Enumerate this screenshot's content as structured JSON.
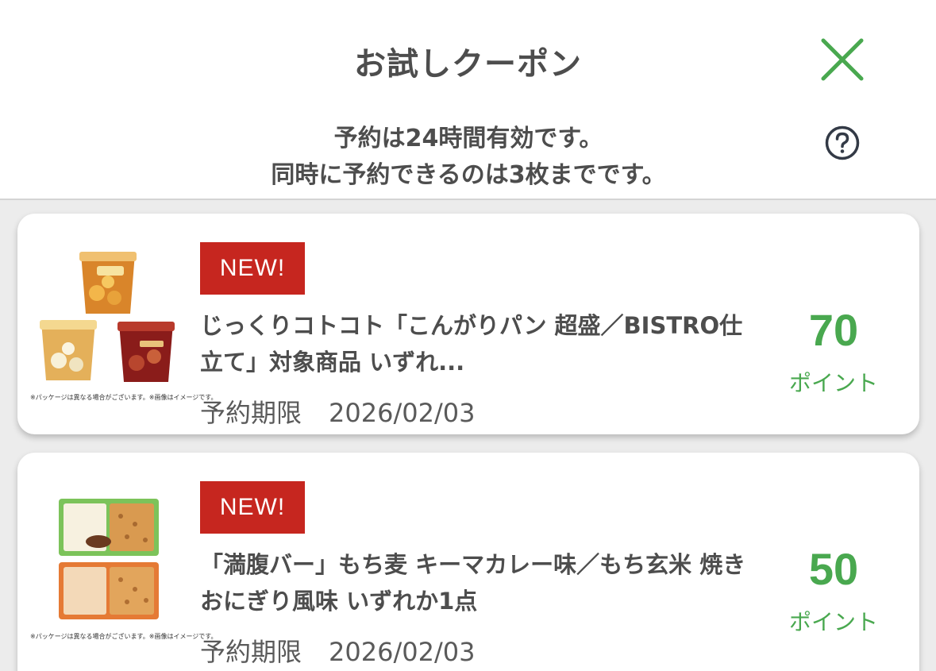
{
  "header": {
    "title": "お試しクーポン",
    "notice_line1": "予約は24時間有効です。",
    "notice_line2": "同時に予約できるのは3枚までです。"
  },
  "colors": {
    "accent_green": "#49a84f",
    "badge_red": "#c6261f",
    "text_gray": "#4d4d4d"
  },
  "icons": {
    "close": "close-icon",
    "help": "question-circle-icon"
  },
  "coupons": [
    {
      "badge": "NEW!",
      "name": "じっくりコトコト「こんがりパン 超盛／BISTRO仕立て」対象商品 いずれ...",
      "deadline_label": "予約期限",
      "deadline_date": "2026/02/03",
      "points": "70",
      "points_unit": "ポイント",
      "image_caption": "※パッケージは異なる場合がございます。※画像はイメージです。"
    },
    {
      "badge": "NEW!",
      "name": "「満腹バー」もち麦 キーマカレー味／もち玄米 焼きおにぎり風味 いずれか1点",
      "deadline_label": "予約期限",
      "deadline_date": "2026/02/03",
      "points": "50",
      "points_unit": "ポイント",
      "image_caption": "※パッケージは異なる場合がございます。※画像はイメージです。"
    }
  ]
}
